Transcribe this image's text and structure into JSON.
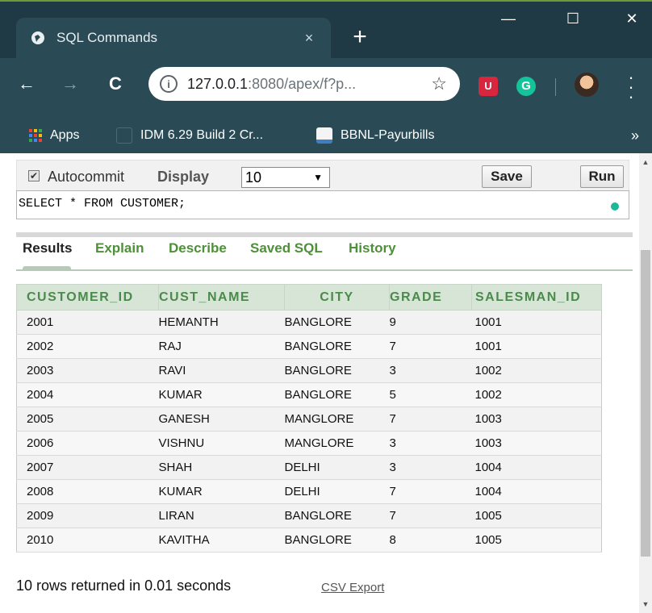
{
  "browser": {
    "tab_title": "SQL Commands",
    "tab_close": "×",
    "new_tab": "+",
    "window_controls": {
      "minimize": "—",
      "maximize": "☐",
      "close": "✕"
    },
    "nav": {
      "back": "←",
      "forward": "→",
      "reload": "C"
    },
    "address": {
      "host": "127.0.0.1",
      "path": ":8080/apex/f?p...",
      "star": "☆"
    },
    "extensions": {
      "red_icon_text": "U",
      "grammarly": "G"
    },
    "bookmarks": [
      {
        "label": "Apps"
      },
      {
        "label": "IDM 6.29 Build 2 Cr..."
      },
      {
        "label": "BBNL-Payurbills"
      }
    ],
    "bookmarks_more": "»"
  },
  "controls": {
    "autocommit_label": "Autocommit",
    "autocommit_checked": true,
    "display_label": "Display",
    "display_value": "10",
    "save_label": "Save",
    "run_label": "Run"
  },
  "sql": {
    "query": "SELECT * FROM CUSTOMER;"
  },
  "result_tabs": [
    "Results",
    "Explain",
    "Describe",
    "Saved SQL",
    "History"
  ],
  "results": {
    "columns": [
      "CUSTOMER_ID",
      "CUST_NAME",
      "CITY",
      "GRADE",
      "SALESMAN_ID"
    ],
    "rows": [
      [
        "2001",
        "HEMANTH",
        "BANGLORE",
        "9",
        "1001"
      ],
      [
        "2002",
        "RAJ",
        "BANGLORE",
        "7",
        "1001"
      ],
      [
        "2003",
        "RAVI",
        "BANGLORE",
        "3",
        "1002"
      ],
      [
        "2004",
        "KUMAR",
        "BANGLORE",
        "5",
        "1002"
      ],
      [
        "2005",
        "GANESH",
        "MANGLORE",
        "7",
        "1003"
      ],
      [
        "2006",
        "VISHNU",
        "MANGLORE",
        "3",
        "1003"
      ],
      [
        "2007",
        "SHAH",
        "DELHI",
        "3",
        "1004"
      ],
      [
        "2008",
        "KUMAR",
        "DELHI",
        "7",
        "1004"
      ],
      [
        "2009",
        "LIRAN",
        "BANGLORE",
        "7",
        "1005"
      ],
      [
        "2010",
        "KAVITHA",
        "BANGLORE",
        "8",
        "1005"
      ]
    ],
    "summary": "10 rows returned in 0.01 seconds",
    "csv_export": "CSV Export"
  },
  "colors": {
    "chrome_bg": "#1f3a44",
    "accent_green": "#4e8f3a",
    "header_bg": "#d7e5d7"
  }
}
